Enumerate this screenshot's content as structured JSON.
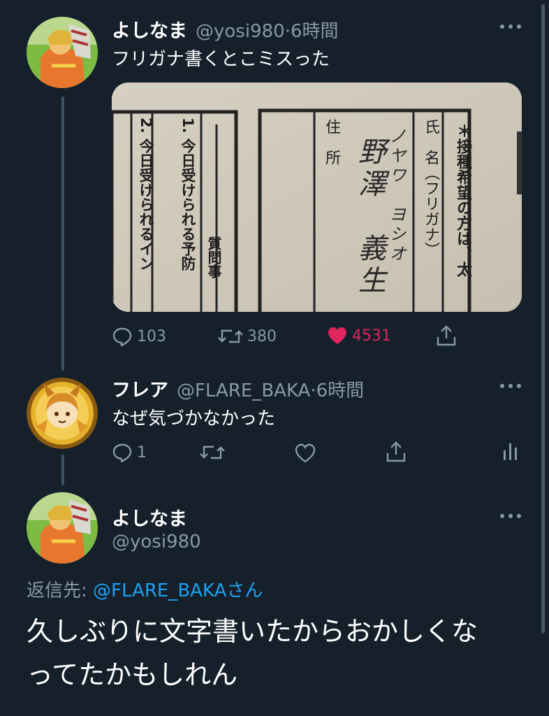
{
  "tweet1": {
    "name": "よしなま",
    "handle": "@yosi980",
    "time": "6時間",
    "text": "フリガナ書くとこミスった",
    "image": {
      "heading_fragment": "＊接種希望の方は、太",
      "field_name_label": "氏　名（フリガナ）",
      "field_address_label": "住　所",
      "handwritten_furigana": "ノヤワ　ヨシオ",
      "handwritten_name": "野澤　義生",
      "question_header": "質問事",
      "question1": "1. 今日受けられる予防",
      "question2": "2. 今日受けられるイン"
    },
    "actions": {
      "reply_count": "103",
      "retweet_count": "380",
      "like_count": "4531"
    }
  },
  "tweet2": {
    "name": "フレア",
    "handle": "@FLARE_BAKA",
    "time": "6時間",
    "text": "なぜ気づかなかった",
    "actions": {
      "reply_count": "1"
    }
  },
  "tweet3": {
    "name": "よしなま",
    "handle": "@yosi980",
    "reply_prefix": "返信先: ",
    "reply_mention": "@FLARE_BAKA",
    "reply_suffix": "さん",
    "text_line1": "久しぶりに文字書いたからおかしくな",
    "text_line2": "ってたかもしれん"
  },
  "colors": {
    "background": "#15202b",
    "secondary_text": "#8899a6",
    "link": "#1da1f2",
    "like": "#e0245e"
  }
}
